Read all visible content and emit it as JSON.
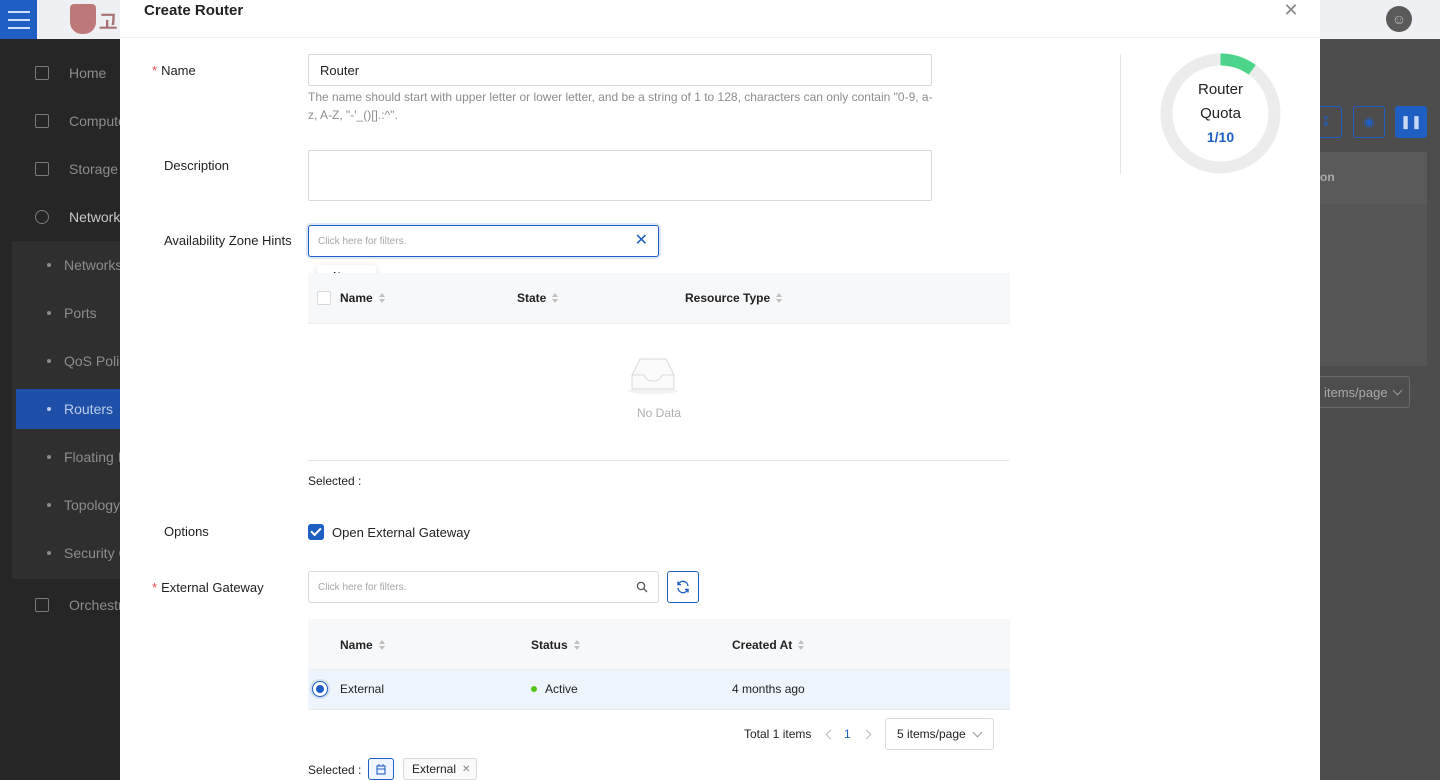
{
  "background": {
    "logo_text": "고",
    "sidebar": {
      "items": [
        {
          "label": "Home"
        },
        {
          "label": "Compute"
        },
        {
          "label": "Storage"
        },
        {
          "label": "Network"
        },
        {
          "label": "Orchestration"
        }
      ],
      "network_sub": [
        {
          "label": "Networks"
        },
        {
          "label": "Ports"
        },
        {
          "label": "QoS Policies"
        },
        {
          "label": "Routers",
          "active": true
        },
        {
          "label": "Floating IPs"
        },
        {
          "label": "Topology"
        },
        {
          "label": "Security Groups"
        }
      ]
    },
    "content": {
      "table_header_partial": "on",
      "page_size": "items/page"
    }
  },
  "modal": {
    "title": "Create Router",
    "name": {
      "label": "Name",
      "value": "Router",
      "hint": "The name should start with upper letter or lower letter, and be a string of 1 to 128, characters can only contain \"0-9, a-z, A-Z, \"-'_()[].:^\"."
    },
    "description": {
      "label": "Description",
      "value": ""
    },
    "az_hints": {
      "label": "Availability Zone Hints",
      "filter_placeholder": "Click here for filters.",
      "tooltip": "Name",
      "columns": [
        "Name",
        "State",
        "Resource Type"
      ],
      "empty_text": "No Data",
      "selected_label": "Selected :"
    },
    "options": {
      "label": "Options",
      "checkbox_label": "Open External Gateway",
      "checked": true
    },
    "external_gateway": {
      "label": "External Gateway",
      "filter_placeholder": "Click here for filters.",
      "columns": [
        "Name",
        "Status",
        "Created At"
      ],
      "rows": [
        {
          "name": "External",
          "status": "Active",
          "created_at": "4 months ago",
          "selected": true
        }
      ],
      "pagination": {
        "total": "Total 1 items",
        "page": "1",
        "page_size": "5 items/page"
      },
      "selected_label": "Selected :",
      "selected_tag": "External"
    },
    "quota": {
      "title_line1": "Router",
      "title_line2": "Quota",
      "value": "1/10",
      "used_fraction": 0.1
    }
  },
  "colors": {
    "primary": "#1f5fc4",
    "success": "#52c41a",
    "quota_used": "#4cd48a",
    "required": "#e34d4d"
  }
}
